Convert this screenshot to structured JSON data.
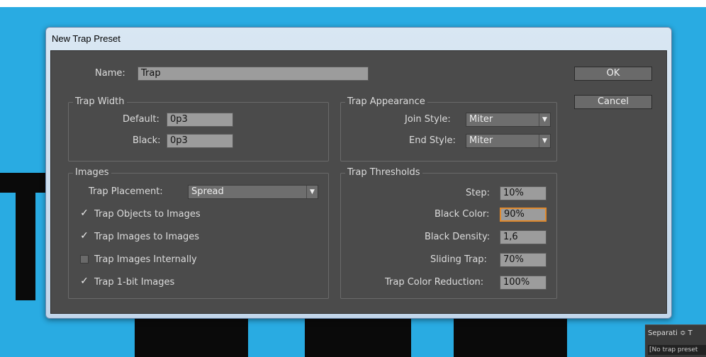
{
  "dialog": {
    "title": "New Trap Preset",
    "name_label": "Name:",
    "name_value": "Trap",
    "ok_label": "OK",
    "cancel_label": "Cancel"
  },
  "trap_width": {
    "title": "Trap Width",
    "default_label": "Default:",
    "default_value": "0p3",
    "black_label": "Black:",
    "black_value": "0p3"
  },
  "trap_appearance": {
    "title": "Trap Appearance",
    "join_label": "Join Style:",
    "join_value": "Miter",
    "end_label": "End Style:",
    "end_value": "Miter"
  },
  "images": {
    "title": "Images",
    "placement_label": "Trap Placement:",
    "placement_value": "Spread",
    "options": [
      {
        "label": "Trap Objects to Images",
        "checked": true
      },
      {
        "label": "Trap Images to Images",
        "checked": true
      },
      {
        "label": "Trap Images Internally",
        "checked": false
      },
      {
        "label": "Trap 1-bit Images",
        "checked": true
      }
    ]
  },
  "trap_thresholds": {
    "title": "Trap Thresholds",
    "step_label": "Step:",
    "step_value": "10%",
    "black_color_label": "Black Color:",
    "black_color_value": "90%",
    "black_density_label": "Black Density:",
    "black_density_value": "1,6",
    "sliding_label": "Sliding Trap:",
    "sliding_value": "70%",
    "reduction_label": "Trap Color Reduction:",
    "reduction_value": "100%"
  },
  "panel": {
    "tab_label": "Separati ≎ T",
    "row_label": "[No trap preset"
  },
  "colors": {
    "background": "#29abe2",
    "dialog_body": "#4b4b4b",
    "focus_ring": "#e08a2e"
  }
}
